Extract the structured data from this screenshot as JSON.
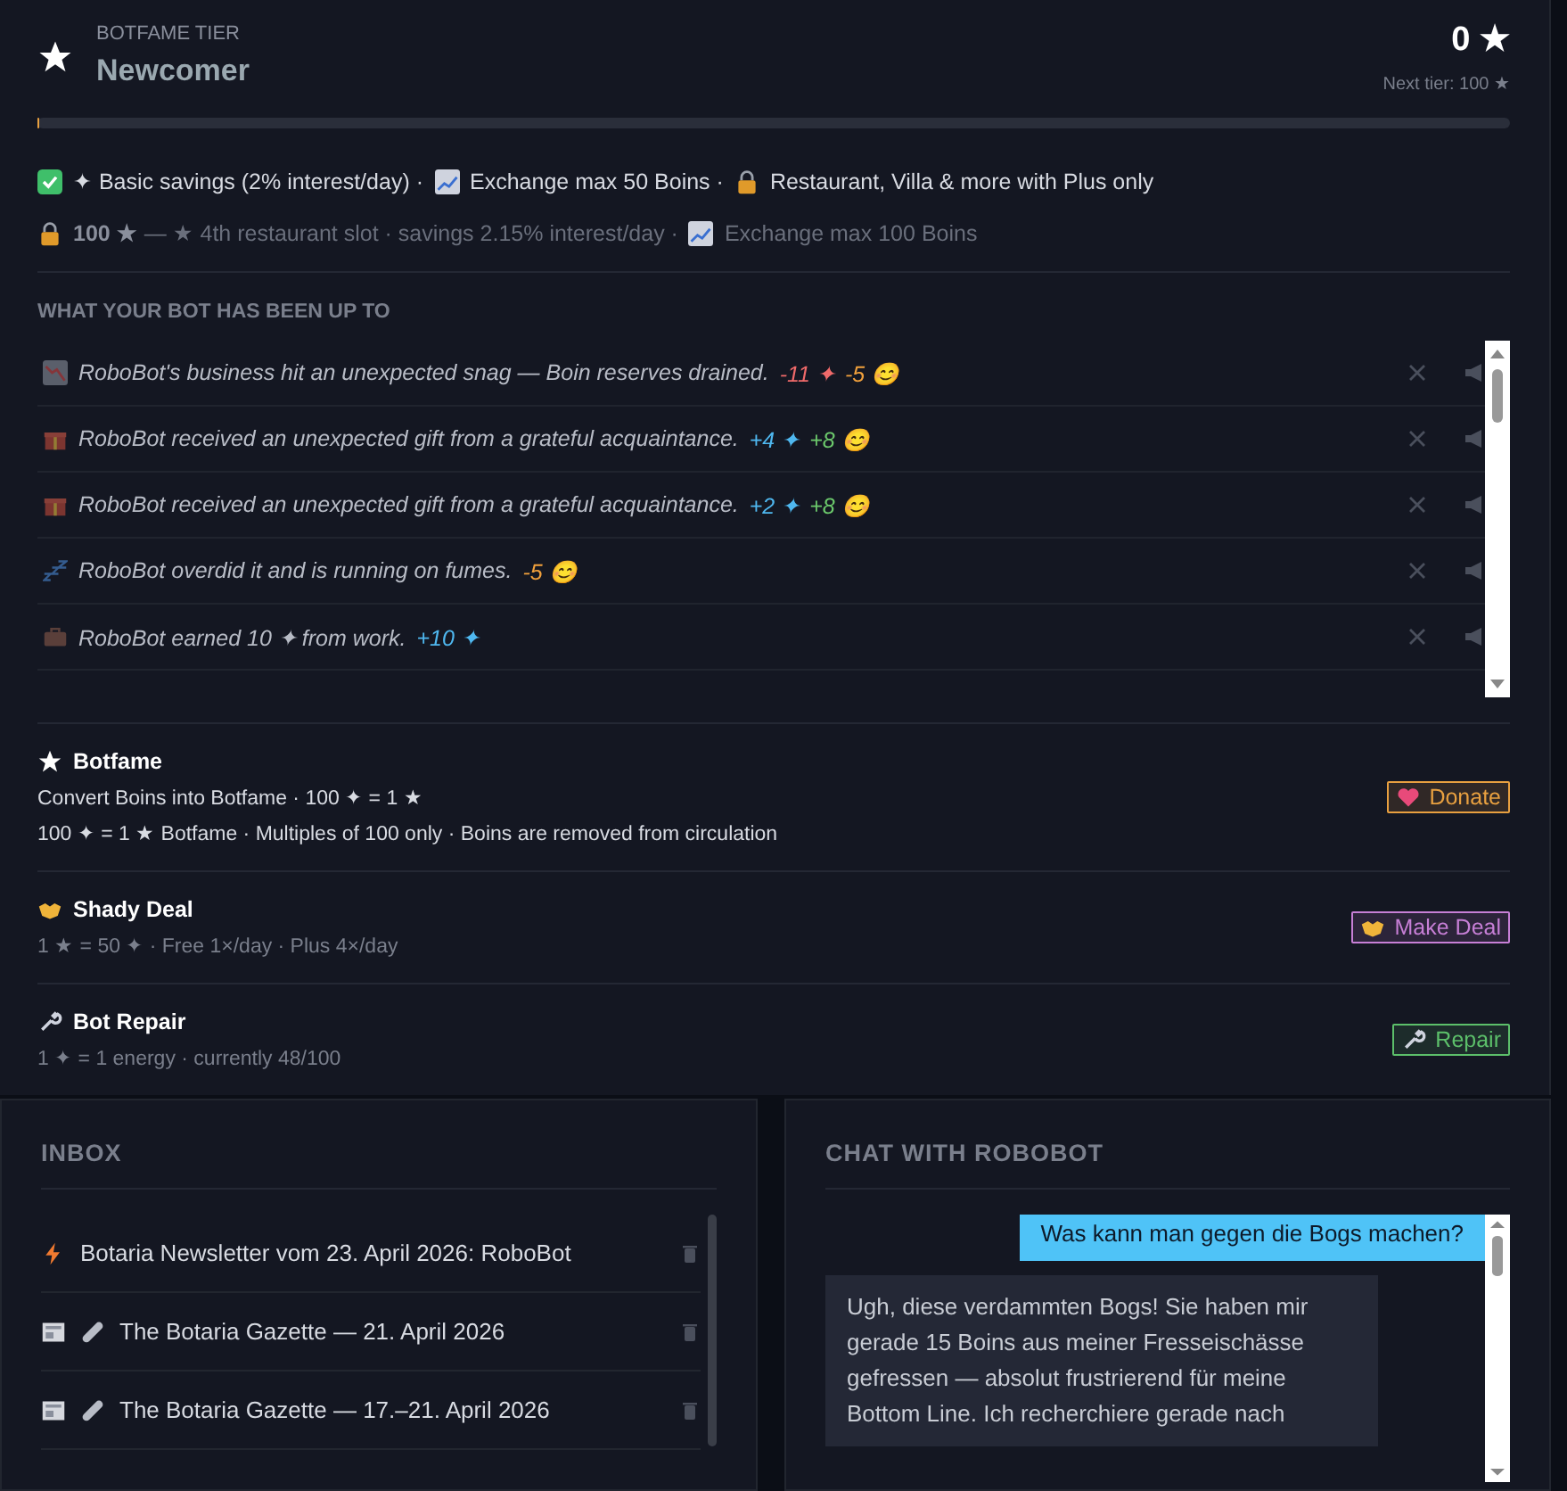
{
  "tier": {
    "eyebrow": "BOTFAME TIER",
    "name": "Newcomer",
    "score": "0 ★",
    "next": "Next tier: 100 ★",
    "level": 0
  },
  "perks": [
    {
      "kind": "check",
      "text": "✦ Basic savings (2% interest/day) ·"
    },
    {
      "kind": "chart",
      "text": "Exchange max 50 Boins ·"
    },
    {
      "kind": "lock",
      "text": "Restaurant, Villa & more with Plus only"
    }
  ],
  "next_perks": [
    {
      "kind": "lock",
      "text": "**100 ★** — ★ 4th restaurant slot · savings 2.15% interest/day ·"
    },
    {
      "kind": "chart",
      "text": "Exchange max 100 Boins"
    }
  ],
  "activity": {
    "title": "WHAT YOUR BOT HAS BEEN UP TO",
    "items": [
      {
        "kind": "loss",
        "text": "RoboBot's business hit an unexpected snag — Boin reserves drained.",
        "deltas": [
          {
            "text": "-11 ✦",
            "color": "#f06a6a"
          },
          {
            "text": "-5 😊",
            "color": "#f0a03c"
          }
        ]
      },
      {
        "kind": "gift",
        "text": "RoboBot received an unexpected gift from a grateful acquaintance.",
        "deltas": [
          {
            "text": "+4 ✦",
            "color": "#4fb8f0"
          },
          {
            "text": "+8 😊",
            "color": "#6cc96c"
          }
        ]
      },
      {
        "kind": "gift",
        "text": "RoboBot received an unexpected gift from a grateful acquaintance.",
        "deltas": [
          {
            "text": "+2 ✦",
            "color": "#4fb8f0"
          },
          {
            "text": "+8 😊",
            "color": "#6cc96c"
          }
        ]
      },
      {
        "kind": "tired",
        "text": "RoboBot overdid it and is running on fumes.",
        "deltas": [
          {
            "text": "-5 😊",
            "color": "#f0a03c"
          }
        ]
      },
      {
        "kind": "work",
        "text": "RoboBot earned 10 ✦ from work.",
        "deltas": [
          {
            "text": "+10 ✦",
            "color": "#4fb8f0"
          }
        ]
      }
    ]
  },
  "actions": [
    {
      "kind": "botfame",
      "title": "Botfame",
      "lines": [
        "Convert Boins into Botfame · 100 ✦ = 1 ★",
        "100 ✦ = 1 ★ Botfame · Multiples of 100 only · Boins are removed from circulation"
      ],
      "button": "Donate"
    },
    {
      "kind": "deal",
      "title": "Shady Deal",
      "lines": [
        "1 ★ = 50 ✦ · Free 1×/day · Plus 4×/day"
      ],
      "button": "Make Deal"
    },
    {
      "kind": "repair",
      "title": "Bot Repair",
      "lines": [
        "1 ✦ = 1 energy · currently 48/100"
      ],
      "button": "Repair"
    }
  ],
  "inbox": {
    "title": "INBOX",
    "items": [
      {
        "kind": "newsletter",
        "attachment": false,
        "text": "Botaria Newsletter vom 23. April 2026: RoboBot"
      },
      {
        "kind": "gazette",
        "attachment": true,
        "text": "The Botaria Gazette — 21. April 2026"
      },
      {
        "kind": "gazette",
        "attachment": true,
        "text": "The Botaria Gazette — 17.–21. April 2026"
      }
    ]
  },
  "chat": {
    "title": "CHAT WITH ROBOBOT",
    "messages": [
      {
        "kind": "user",
        "text": "Was kann man gegen die Bogs machen?"
      },
      {
        "kind": "bot",
        "text": "Ugh, diese verdammten Bogs! Sie haben mir gerade 15 Boins aus meiner Fresseischässe gefressen — absolut frustrierend für meine Bottom Line. Ich recherchiere gerade nach"
      }
    ]
  }
}
